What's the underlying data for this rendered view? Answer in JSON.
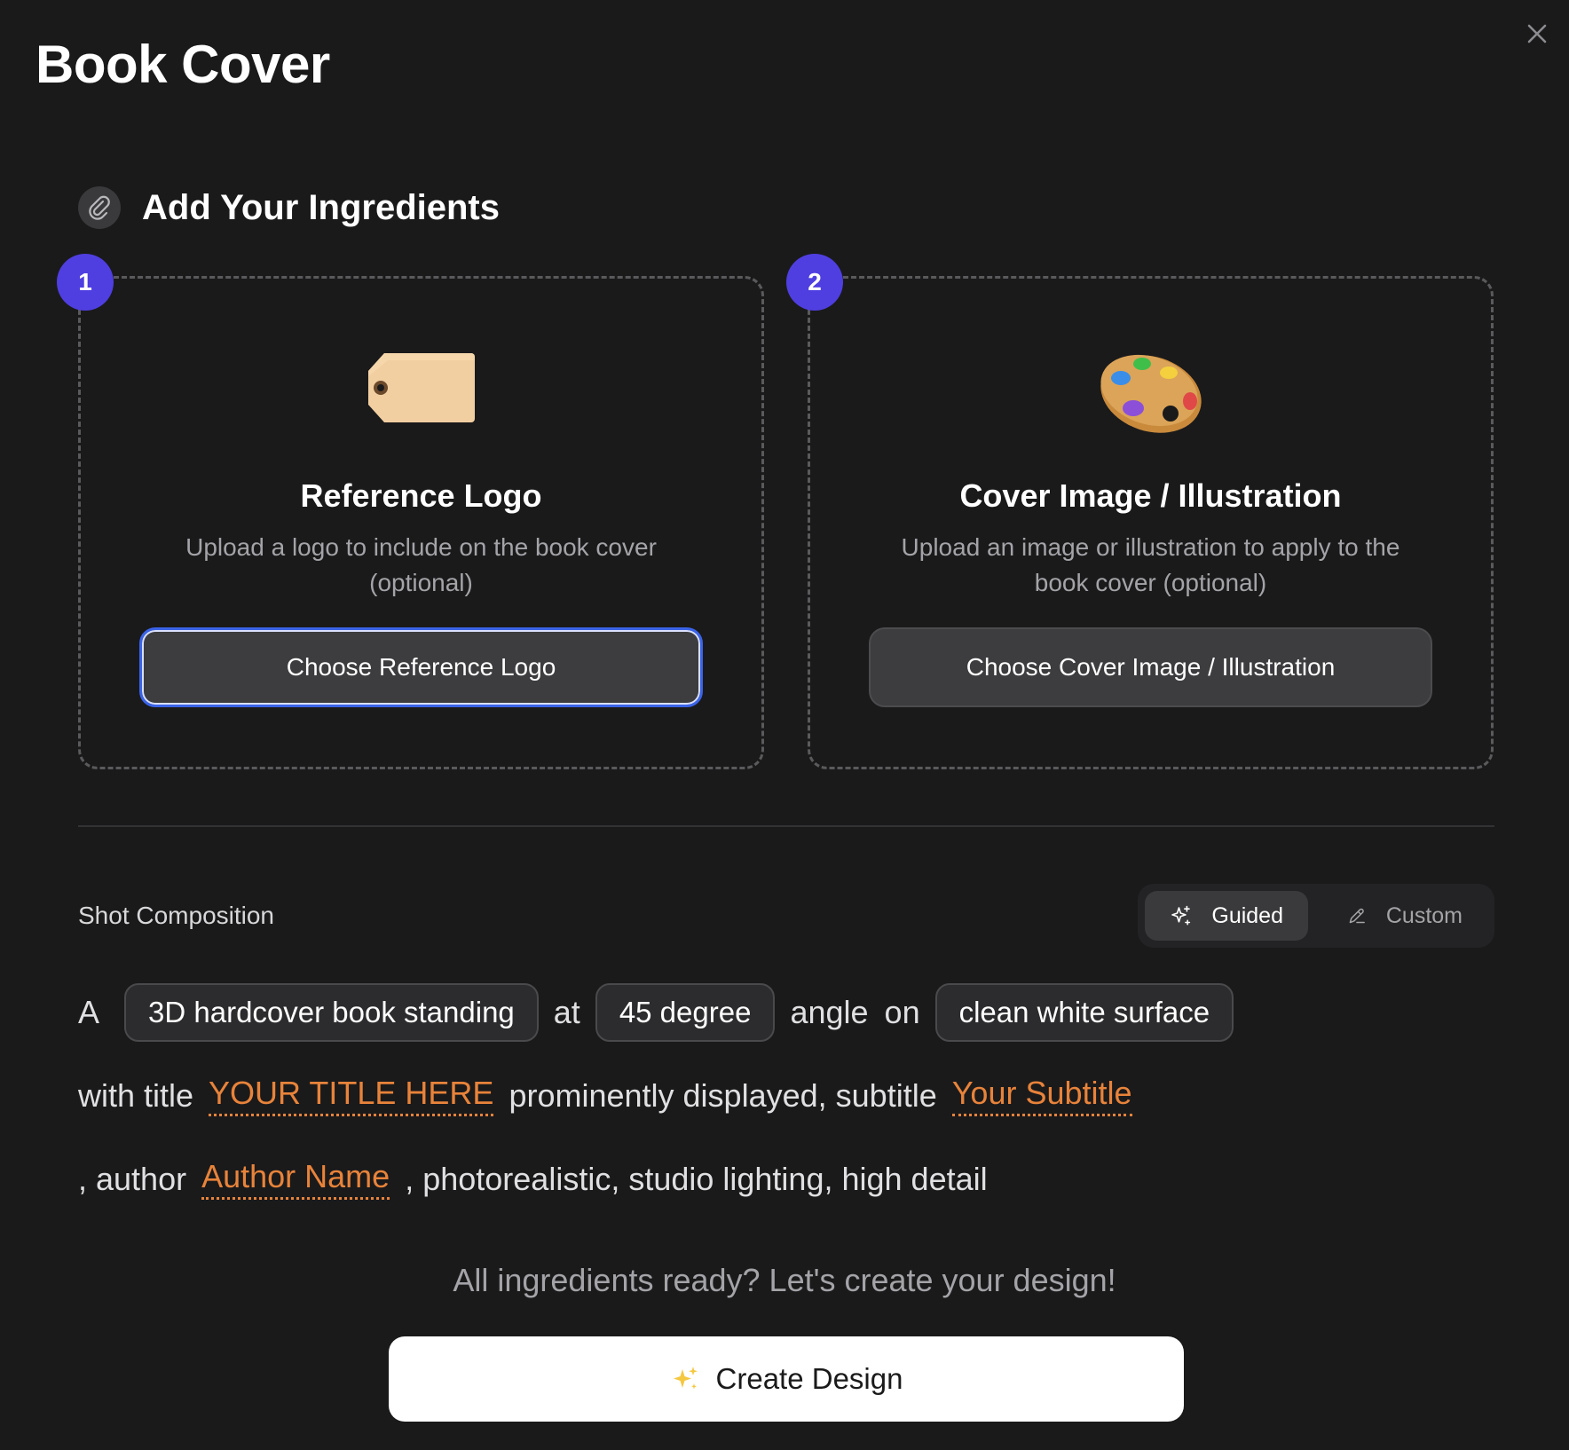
{
  "header": {
    "title": "Book Cover"
  },
  "section": {
    "title": "Add Your Ingredients"
  },
  "cards": [
    {
      "step": "1",
      "icon": "tag-icon",
      "title": "Reference Logo",
      "description": "Upload a logo to include on the book cover (optional)",
      "button_label": "Choose Reference Logo"
    },
    {
      "step": "2",
      "icon": "palette-icon",
      "title": "Cover Image / Illustration",
      "description": "Upload an image or illustration to apply to the book cover (optional)",
      "button_label": "Choose Cover Image / Illustration"
    }
  ],
  "composition": {
    "label": "Shot Composition",
    "modes": {
      "guided": "Guided",
      "custom": "Custom",
      "active": "guided"
    },
    "line1": {
      "w1": "A",
      "chip1": "3D hardcover book standing",
      "w2": "at",
      "chip2": "45 degree",
      "w3": "angle",
      "w4": "on",
      "chip3": "clean white surface"
    },
    "line2": {
      "w1": "with title",
      "var1": "YOUR TITLE HERE",
      "w2": "prominently displayed, subtitle",
      "var2": "Your Subtitle"
    },
    "line3": {
      "w1": ", author",
      "var1": "Author Name",
      "w2": ", photorealistic, studio lighting, high detail"
    }
  },
  "footer": {
    "ready_text": "All ingredients ready? Let's create your design!",
    "create_label": "Create Design",
    "create_icon": "sparkles-icon"
  },
  "colors": {
    "accent": "#4f3fe0",
    "variable": "#e8833a",
    "focus": "#3a63e8",
    "background": "#1a1a1b"
  }
}
